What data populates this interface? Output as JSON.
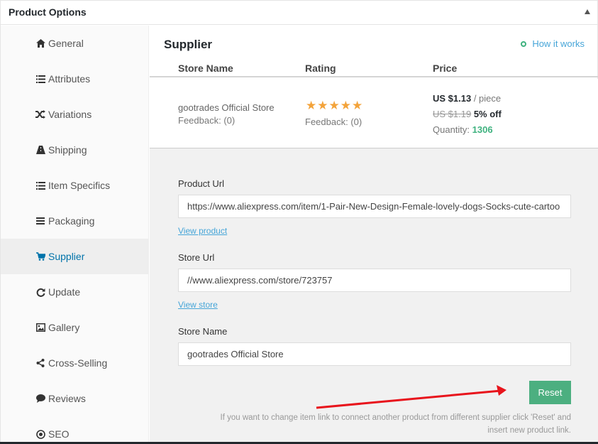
{
  "panel": {
    "title": "Product Options"
  },
  "sidebar": {
    "items": [
      {
        "label": "General",
        "icon": "home-icon",
        "glyph": "⌂"
      },
      {
        "label": "Attributes",
        "icon": "list-icon",
        "glyph": "☰"
      },
      {
        "label": "Variations",
        "icon": "shuffle-icon",
        "glyph": "⤨"
      },
      {
        "label": "Shipping",
        "icon": "truck-icon",
        "glyph": "▲"
      },
      {
        "label": "Item Specifics",
        "icon": "list-icon",
        "glyph": "☰"
      },
      {
        "label": "Packaging",
        "icon": "bars-icon",
        "glyph": "≡"
      },
      {
        "label": "Supplier",
        "icon": "cart-icon",
        "glyph": "🛒"
      },
      {
        "label": "Update",
        "icon": "refresh-icon",
        "glyph": "⟳"
      },
      {
        "label": "Gallery",
        "icon": "image-icon",
        "glyph": "▣"
      },
      {
        "label": "Cross-Selling",
        "icon": "share-icon",
        "glyph": "⋖"
      },
      {
        "label": "Reviews",
        "icon": "comment-icon",
        "glyph": "●"
      },
      {
        "label": "SEO",
        "icon": "target-icon",
        "glyph": "◉"
      }
    ],
    "active": "Supplier"
  },
  "supplier": {
    "title": "Supplier",
    "how_it_works": "How it works",
    "columns": {
      "store": "Store Name",
      "rating": "Rating",
      "price": "Price"
    },
    "row": {
      "store_name": "gootrades Official Store",
      "store_feedback": "Feedback: (0)",
      "rating_feedback": "Feedback: (0)",
      "stars": 5,
      "price": "US $1.13",
      "unit": "/ piece",
      "old_price": "US $1.19",
      "discount": "5% off",
      "quantity_label": "Quantity:",
      "quantity": "1306"
    }
  },
  "form": {
    "product_url_label": "Product Url",
    "product_url": "https://www.aliexpress.com/item/1-Pair-New-Design-Female-lovely-dogs-Socks-cute-cartoo",
    "view_product": "View product",
    "store_url_label": "Store Url",
    "store_url": "//www.aliexpress.com/store/723757",
    "view_store": "View store",
    "store_name_label": "Store Name",
    "store_name": "gootrades Official Store",
    "reset": "Reset",
    "help_line1": "If you want to change item link to connect another product from different supplier click 'Reset' and",
    "help_line2": "insert new product link."
  },
  "colors": {
    "accent": "#4caf80",
    "link": "#46a5d8",
    "star": "#f3a33a",
    "arrow": "#e8141c"
  }
}
